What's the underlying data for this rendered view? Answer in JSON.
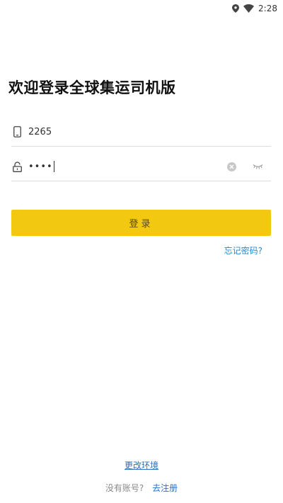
{
  "status_bar": {
    "time": "2:28",
    "icons": [
      "location-icon",
      "wifi-icon"
    ]
  },
  "title": "欢迎登录全球集运司机版",
  "phone_field": {
    "icon": "phone-icon",
    "value": "2265"
  },
  "password_field": {
    "icon": "lock-icon",
    "value": "••••",
    "clear_icon": "clear-icon",
    "toggle_icon": "eye-closed-icon"
  },
  "login_button": {
    "label": "登录",
    "color": "#f2c811"
  },
  "forgot_password": "忘记密码?",
  "change_environment": "更改环境",
  "register": {
    "prompt": "没有账号?",
    "link": "去注册"
  },
  "colors": {
    "accent": "#f2c811",
    "link": "#2b8ad0"
  }
}
